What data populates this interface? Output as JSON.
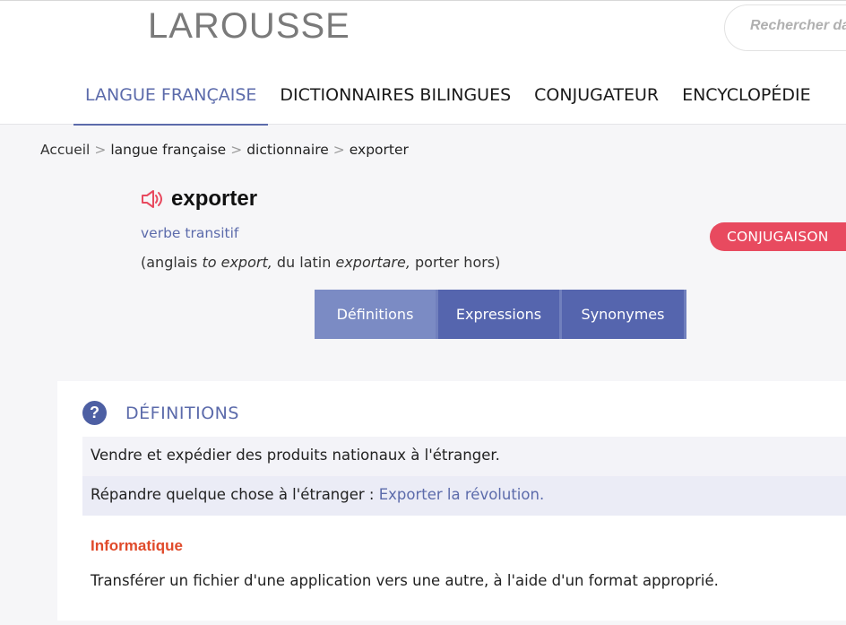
{
  "header": {
    "logo": "LAROUSSE",
    "search_placeholder": "Rechercher dans"
  },
  "nav": {
    "items": [
      {
        "label": "LANGUE FRANÇAISE",
        "active": true
      },
      {
        "label": "DICTIONNAIRES BILINGUES"
      },
      {
        "label": "CONJUGATEUR"
      },
      {
        "label": "ENCYCLOPÉDIE"
      }
    ]
  },
  "breadcrumb": {
    "home": "Accueil",
    "level1": "langue française",
    "level2": "dictionnaire",
    "current": "exporter",
    "separator": ">"
  },
  "entry": {
    "word": "exporter",
    "pos": "verbe transitif",
    "etymology": {
      "part1": "(anglais ",
      "term1": "to export,",
      "part2": " du latin ",
      "term2": "exportare,",
      "part3": " porter hors)"
    },
    "conjugaison_label": "CONJUGAISON",
    "speaker_icon": "speaker-icon"
  },
  "tabs": [
    {
      "label": "Définitions",
      "active": true
    },
    {
      "label": "Expressions"
    },
    {
      "label": "Synonymes"
    }
  ],
  "definitions": {
    "title": "DÉFINITIONS",
    "icon": "question-icon",
    "items": [
      {
        "text": "Vendre et expédier des produits nationaux à l'étranger."
      },
      {
        "text": "Répandre quelque chose à l'étranger : ",
        "example": "Exporter la révolution."
      }
    ],
    "domain": "Informatique",
    "domain_def": "Transférer un fichier d'une application vers une autre, à l'aide d'un format approprié."
  },
  "colors": {
    "accent": "#5c6bab",
    "conjugaison": "#e84a5f",
    "domain": "#e04a2a"
  }
}
